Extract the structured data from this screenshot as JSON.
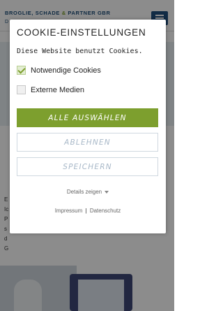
{
  "background": {
    "brand_part1": "BROGLIE, SCHADE",
    "brand_amp": "&",
    "brand_part2": "PARTNER GBR",
    "brand_sub": "D",
    "text_fragments": [
      "E",
      "Ic",
      "P",
      "s",
      "d",
      "G"
    ]
  },
  "cookie_dialog": {
    "title": "COOKIE-EINSTELLUNGEN",
    "description": "Diese Website benutzt Cookies.",
    "options": [
      {
        "label": "Notwendige Cookies",
        "checked": true
      },
      {
        "label": "Externe Medien",
        "checked": false
      }
    ],
    "buttons": {
      "select_all": "ALLE AUSWÄHLEN",
      "decline": "ABLEHNEN",
      "save": "SPEICHERN"
    },
    "details_link": "Details zeigen",
    "footer": {
      "imprint": "Impressum",
      "separator": "|",
      "privacy": "Datenschutz"
    }
  },
  "colors": {
    "accent_green": "#7d9f2e",
    "brand_blue": "#1d4d79"
  }
}
